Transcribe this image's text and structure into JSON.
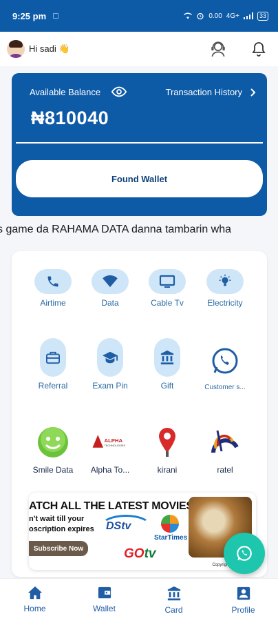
{
  "status_bar": {
    "time": "9:25 pm",
    "network": "4G+",
    "speed": "0.00",
    "battery": "33"
  },
  "header": {
    "greeting": "Hi sadi 👋"
  },
  "balance": {
    "label": "Available Balance",
    "history_link": "Transaction History",
    "amount": "₦810040",
    "fund_button": "Found Wallet"
  },
  "marquee_text": "s game da RAHAMA DATA danna tambarin wha",
  "services": [
    {
      "label": "Airtime",
      "icon": "phone-icon"
    },
    {
      "label": "Data",
      "icon": "wifi-icon"
    },
    {
      "label": "Cable Tv",
      "icon": "tv-icon"
    },
    {
      "label": "Electricity",
      "icon": "bulb-icon"
    },
    {
      "label": "Referral",
      "icon": "briefcase-icon"
    },
    {
      "label": "Exam Pin",
      "icon": "graduation-cap-icon"
    },
    {
      "label": "Gift",
      "icon": "bank-icon"
    },
    {
      "label": "Customer s...",
      "icon": "whatsapp-icon"
    },
    {
      "label": "Smile Data",
      "icon": "smile-logo"
    },
    {
      "label": "Alpha To...",
      "icon": "alpha-logo"
    },
    {
      "label": "kirani",
      "icon": "map-pin-logo"
    },
    {
      "label": "ratel",
      "icon": "ratel-logo"
    }
  ],
  "banner": {
    "title": "ATCH ALL THE LATEST MOVIES",
    "line1": "n't wait till your",
    "line2": "oscription expires",
    "cta": "Subscribe Now",
    "brand1": "DStv",
    "brand2": "StarTimes",
    "brand3_a": "GO",
    "brand3_b": "tv",
    "copyright": "Copyright © Topupm...",
    "alpha_name": "ALPHA",
    "alpha_sub": "TECHNOLOGIES"
  },
  "nav": [
    {
      "label": "Home",
      "icon": "home-icon"
    },
    {
      "label": "Wallet",
      "icon": "wallet-icon"
    },
    {
      "label": "Card",
      "icon": "bank-card-icon"
    },
    {
      "label": "Profile",
      "icon": "profile-icon"
    }
  ],
  "colors": {
    "primary": "#0d5aa7",
    "pill": "#cfe6f8",
    "fab": "#1dc6ac",
    "label": "#2a6aa3"
  }
}
